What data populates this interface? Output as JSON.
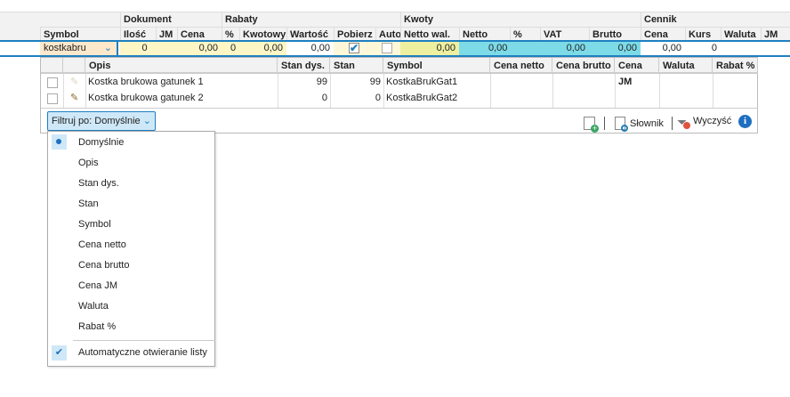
{
  "header": {
    "groups": [
      "Dokument",
      "Rabaty",
      "Kwoty",
      "Cennik"
    ],
    "columns": [
      "Symbol",
      "Ilość",
      "JM",
      "Cena",
      "%",
      "Kwotowy",
      "Wartość",
      "Pobierz",
      "Auto",
      "Netto wal.",
      "Netto",
      "%",
      "VAT",
      "Brutto",
      "Cena",
      "Kurs",
      "Waluta",
      "JM"
    ]
  },
  "input_row": {
    "symbol": "kostkabru",
    "ilosc": "0",
    "cena": "0,00",
    "rabat_pct": "0",
    "kwotowy": "0,00",
    "wartosc": "0,00",
    "pobierz": true,
    "auto": false,
    "netto_wal": "0,00",
    "netto": "0,00",
    "vat": "0,00",
    "brutto": "0,00",
    "cennik_cena": "0,00",
    "kurs": "0"
  },
  "list": {
    "columns": [
      "Opis",
      "Stan dys.",
      "Stan",
      "Symbol",
      "Cena netto",
      "Cena brutto",
      "Cena JM",
      "Waluta",
      "Rabat %"
    ],
    "rows": [
      {
        "opis": "Kostka brukowa gatunek 1",
        "stan_dys": "99",
        "stan": "99",
        "symbol": "KostkaBrukGat1"
      },
      {
        "opis": "Kostka brukowa gatunek 2",
        "stan_dys": "0",
        "stan": "0",
        "symbol": "KostkaBrukGat2"
      }
    ],
    "filter_label": "Filtruj po: Domyślnie",
    "slownik": "Słownik",
    "wyczysc": "Wyczyść"
  },
  "filter_menu": {
    "items": [
      "Domyślnie",
      "Opis",
      "Stan dys.",
      "Stan",
      "Symbol",
      "Cena netto",
      "Cena brutto",
      "Cena JM",
      "Waluta",
      "Rabat %"
    ],
    "selected": "Domyślnie",
    "auto_open": "Automatyczne otwieranie listy",
    "auto_open_checked": true
  },
  "colors": {
    "accent": "#1e7fc0",
    "cyan": "#7ddbe8",
    "yellow": "#fff6c6",
    "lime": "#eef0a0"
  }
}
